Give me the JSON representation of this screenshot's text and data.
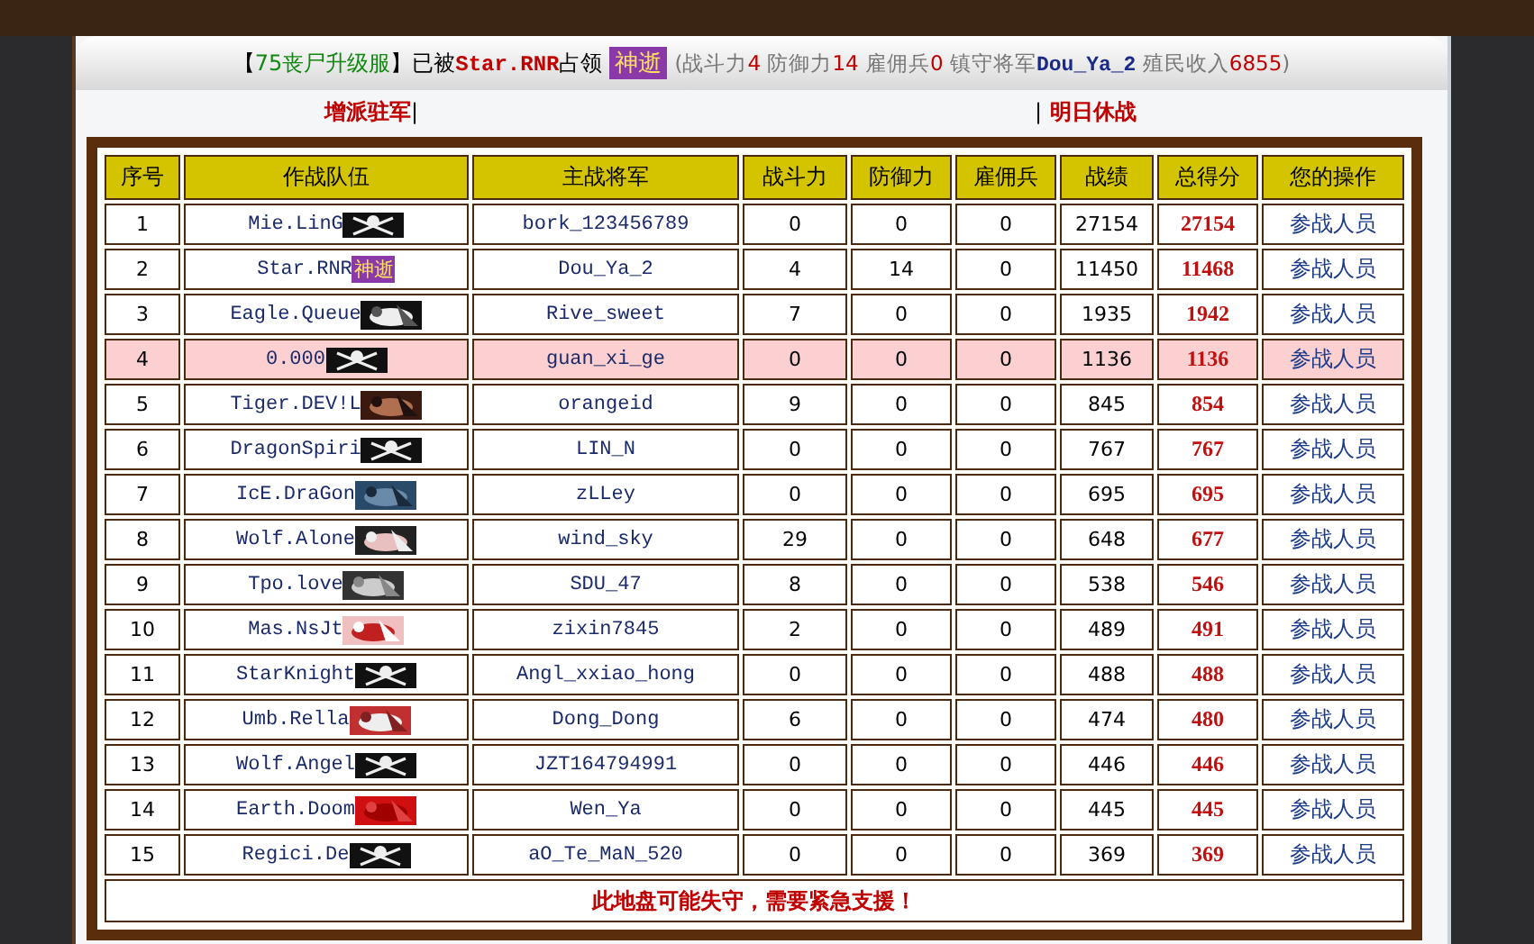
{
  "banner": {
    "parts": [
      {
        "text": "【",
        "kind": "plain"
      },
      {
        "text": "75丧尸升级服",
        "kind": "server"
      },
      {
        "text": "】已被",
        "kind": "plain"
      },
      {
        "text": "Star.RNR",
        "kind": "player"
      },
      {
        "text": "占领",
        "kind": "plain"
      }
    ],
    "badge": "神逝",
    "stats": [
      {
        "text": "(战斗力",
        "kind": "label"
      },
      {
        "text": "4",
        "kind": "number"
      },
      {
        "text": " 防御力",
        "kind": "label"
      },
      {
        "text": "14",
        "kind": "number"
      },
      {
        "text": " 雇佣兵",
        "kind": "label"
      },
      {
        "text": "0",
        "kind": "number"
      },
      {
        "text": " 镇守将军",
        "kind": "label"
      },
      {
        "text": "Dou_Ya_2",
        "kind": "general"
      },
      {
        "text": " 殖民收入",
        "kind": "label"
      },
      {
        "text": "6855",
        "kind": "number"
      },
      {
        "text": ")",
        "kind": "label"
      }
    ]
  },
  "actions": [
    {
      "label": "增派驻军",
      "separator": "|"
    },
    {
      "label": "明日休战",
      "separator": "|"
    }
  ],
  "table": {
    "columns": [
      "序号",
      "作战队伍",
      "主战将军",
      "战斗力",
      "防御力",
      "雇佣兵",
      "战绩",
      "总得分",
      "您的操作"
    ],
    "rows": [
      {
        "rank": "1",
        "team": "Mie.LinG",
        "emblem": {
          "kind": "flag"
        },
        "general": "bork_123456789",
        "attack": "0",
        "defense": "0",
        "mercenaries": "0",
        "record": "27154",
        "total": "27154",
        "action": "参战人员",
        "highlighted": false
      },
      {
        "rank": "2",
        "team": "Star.RNR",
        "emblem": {
          "kind": "text",
          "text": "神逝"
        },
        "general": "Dou_Ya_2",
        "attack": "4",
        "defense": "14",
        "mercenaries": "0",
        "record": "11450",
        "total": "11468",
        "action": "参战人员",
        "highlighted": false
      },
      {
        "rank": "3",
        "team": "Eagle.Queue",
        "general": "Rive_sweet",
        "attack": "7",
        "defense": "0",
        "mercenaries": "0",
        "record": "1935",
        "total": "1942",
        "action": "参战人员",
        "highlighted": false
      },
      {
        "rank": "4",
        "team": "0.000",
        "emblem": {
          "kind": "flag"
        },
        "general": "guan_xi_ge",
        "attack": "0",
        "defense": "0",
        "mercenaries": "0",
        "record": "1136",
        "total": "1136",
        "action": "参战人员",
        "highlighted": true
      },
      {
        "rank": "5",
        "team": "Tiger.DEV!L",
        "general": "orangeid",
        "attack": "9",
        "defense": "0",
        "mercenaries": "0",
        "record": "845",
        "total": "854",
        "action": "参战人员",
        "highlighted": false
      },
      {
        "rank": "6",
        "team": "DragonSpiri",
        "emblem": {
          "kind": "flag"
        },
        "general": "LIN_N",
        "attack": "0",
        "defense": "0",
        "mercenaries": "0",
        "record": "767",
        "total": "767",
        "action": "参战人员",
        "highlighted": false
      },
      {
        "rank": "7",
        "team": "IcE.DraGon",
        "general": "zLLey",
        "attack": "0",
        "defense": "0",
        "mercenaries": "0",
        "record": "695",
        "total": "695",
        "action": "参战人员",
        "highlighted": false
      },
      {
        "rank": "8",
        "team": "Wolf.Alone",
        "general": "wind_sky",
        "attack": "29",
        "defense": "0",
        "mercenaries": "0",
        "record": "648",
        "total": "677",
        "action": "参战人员",
        "highlighted": false
      },
      {
        "rank": "9",
        "team": "Tpo.love",
        "general": "SDU_47",
        "attack": "8",
        "defense": "0",
        "mercenaries": "0",
        "record": "538",
        "total": "546",
        "action": "参战人员",
        "highlighted": false
      },
      {
        "rank": "10",
        "team": "Mas.NsJt",
        "general": "zixin7845",
        "attack": "2",
        "defense": "0",
        "mercenaries": "0",
        "record": "489",
        "total": "491",
        "action": "参战人员",
        "highlighted": false
      },
      {
        "rank": "11",
        "team": "StarKnight",
        "emblem": {
          "kind": "flag"
        },
        "general": "Angl_xxiao_hong",
        "attack": "0",
        "defense": "0",
        "mercenaries": "0",
        "record": "488",
        "total": "488",
        "action": "参战人员",
        "highlighted": false
      },
      {
        "rank": "12",
        "team": "Umb.Rella",
        "general": "Dong_Dong",
        "attack": "6",
        "defense": "0",
        "mercenaries": "0",
        "record": "474",
        "total": "480",
        "action": "参战人员",
        "highlighted": false
      },
      {
        "rank": "13",
        "team": "Wolf.Angel",
        "emblem": {
          "kind": "flag"
        },
        "general": "JZT164794991",
        "attack": "0",
        "defense": "0",
        "mercenaries": "0",
        "record": "446",
        "total": "446",
        "action": "参战人员",
        "highlighted": false
      },
      {
        "rank": "14",
        "team": "Earth.Doom",
        "general": "Wen_Ya",
        "attack": "0",
        "defense": "0",
        "mercenaries": "0",
        "record": "445",
        "total": "445",
        "action": "参战人员",
        "highlighted": false
      },
      {
        "rank": "15",
        "team": "Regici.De",
        "emblem": {
          "kind": "flag"
        },
        "general": "aO_Te_MaN_520",
        "attack": "0",
        "defense": "0",
        "mercenaries": "0",
        "record": "369",
        "total": "369",
        "action": "参战人员",
        "highlighted": false
      }
    ],
    "footer": "此地盘可能失守，需要紧急支援！"
  }
}
